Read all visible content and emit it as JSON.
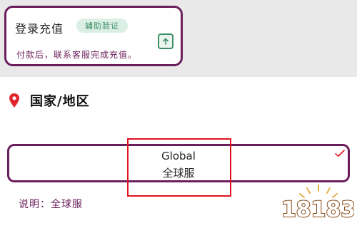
{
  "login_card": {
    "title": "登录充值",
    "badge": "辅助验证",
    "note": "付款后，联系客服完成充值。",
    "upload_icon": "upload-icon"
  },
  "region": {
    "icon": "location-pin-icon",
    "title": "国家/地区"
  },
  "server_select": {
    "name_en": "Global",
    "name_cn": "全球服",
    "selected_icon": "check-icon"
  },
  "explain": {
    "text": "说明：全球服"
  },
  "watermark": {
    "text": "18183"
  },
  "colors": {
    "accent": "#6b1e5c",
    "badge_bg": "#dcefe6",
    "badge_text": "#3a8f66",
    "pin": "#e0262d",
    "highlight": "#e1121d",
    "watermark_stroke": "#8a4f1a",
    "watermark_fill": "#ffffff",
    "top_band_bg": "#e9e9e9"
  }
}
